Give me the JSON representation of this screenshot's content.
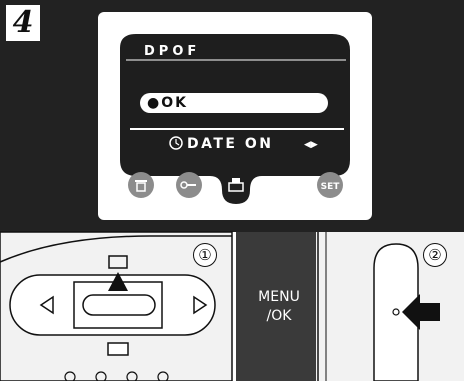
{
  "step": {
    "number": "4"
  },
  "lcd": {
    "title": "DPOF",
    "selected_option": "●OK",
    "date_setting": "DATE  ON",
    "date_arrows": "◀▶"
  },
  "bottom_icons": [
    {
      "icon": "trash-icon"
    },
    {
      "icon": "key-protect-icon"
    },
    {
      "icon": "print-icon"
    },
    {
      "icon": "set-icon",
      "label": "SET"
    }
  ],
  "camera": {
    "step1_marker": "①",
    "step2_marker": "②",
    "menu_button_label": "MENU\n/OK"
  },
  "colors": {
    "screen_background": "#222222",
    "panel_background": "#ffffff",
    "lcd_dark": "#1e1e1e",
    "icon_gray": "#8c8c8c",
    "option_highlight": "#ffffff"
  }
}
